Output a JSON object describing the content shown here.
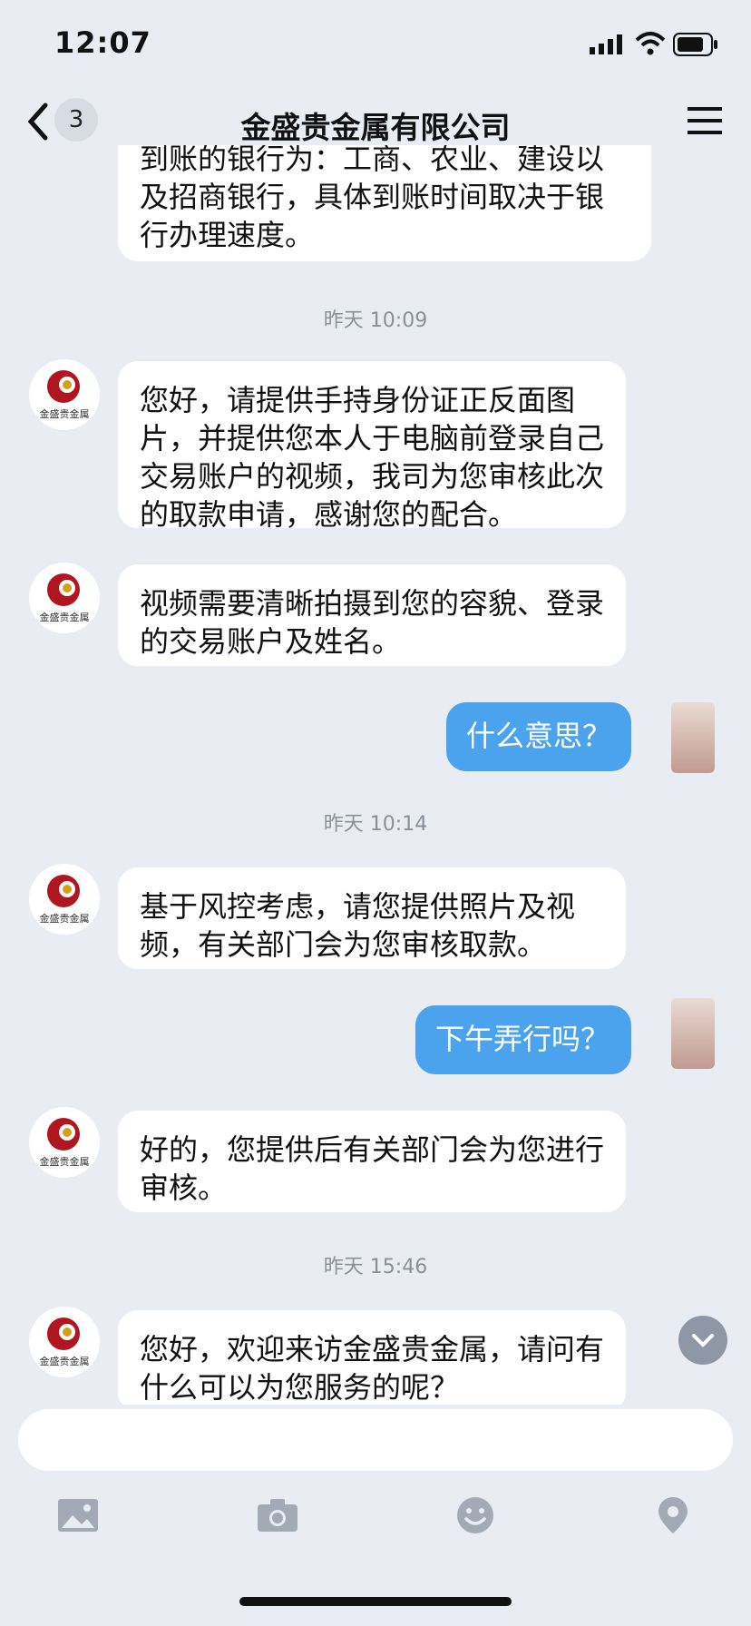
{
  "status": {
    "time": "12:07"
  },
  "nav": {
    "badge": "3",
    "title": "金盛贵金属有限公司"
  },
  "brand": {
    "avatar_text": "金盛贵金属"
  },
  "messages": [
    {
      "type": "incoming",
      "text": "到账的银行为：工商、农业、建设以及招商银行，具体到账时间取决于银行办理速度。"
    },
    {
      "type": "timestamp",
      "text": "昨天 10:09"
    },
    {
      "type": "incoming",
      "text": "您好，请提供手持身份证正反面图片，并提供您本人于电脑前登录自己交易账户的视频，我司为您审核此次的取款申请，感谢您的配合。"
    },
    {
      "type": "incoming",
      "text": "视频需要清晰拍摄到您的容貌、登录的交易账户及姓名。"
    },
    {
      "type": "outgoing",
      "text": "什么意思？"
    },
    {
      "type": "timestamp",
      "text": "昨天 10:14"
    },
    {
      "type": "incoming",
      "text": "基于风控考虑，请您提供照片及视频，有关部门会为您审核取款。"
    },
    {
      "type": "outgoing",
      "text": "下午弄行吗？"
    },
    {
      "type": "incoming",
      "text": "好的，您提供后有关部门会为您进行审核。"
    },
    {
      "type": "timestamp",
      "text": "昨天 15:46"
    },
    {
      "type": "incoming",
      "text": "您好，欢迎来访金盛贵金属，请问有什么可以为您服务的呢？"
    }
  ],
  "input": {
    "placeholder": ""
  },
  "toolbar": [
    "image-icon",
    "camera-icon",
    "emoji-icon",
    "location-icon"
  ],
  "colors": {
    "background": "#e9ecf3",
    "outgoing_bubble": "#4aa3ec",
    "incoming_bubble": "#ffffff"
  }
}
